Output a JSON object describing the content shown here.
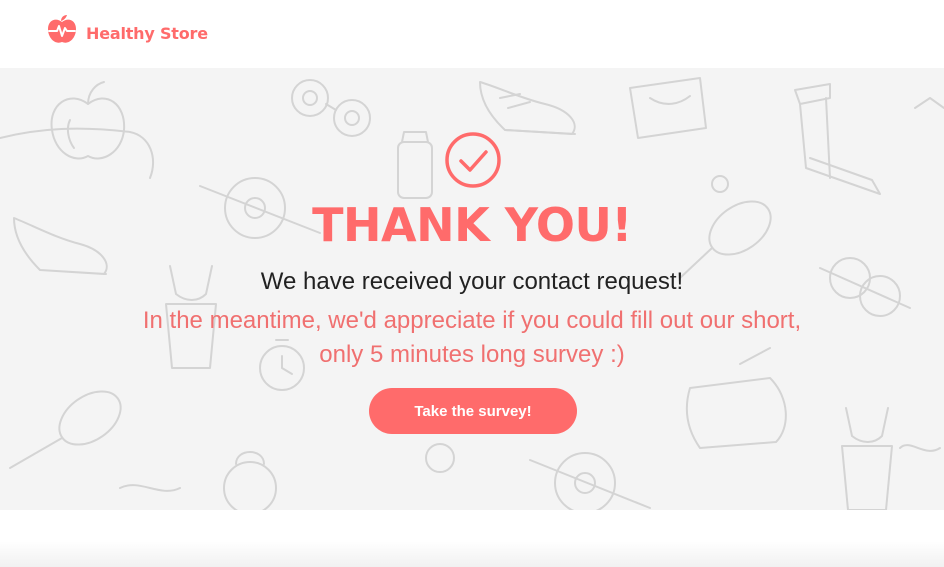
{
  "header": {
    "brand_name": "Healthy Store"
  },
  "hero": {
    "title": "THANK YOU!",
    "subtitle": "We have received your contact request!",
    "note_line1": "In the meantime, we'd appreciate if you could fill out our short,",
    "note_line2": "only 5 minutes long survey :)",
    "cta_label": "Take the survey!"
  },
  "colors": {
    "accent": "#ff6b6b",
    "hero_background": "#f4f4f4",
    "doodle_stroke": "#d6d6d6"
  },
  "icons": {
    "logo": "apple-heartbeat-icon",
    "success": "check-circle-icon"
  }
}
